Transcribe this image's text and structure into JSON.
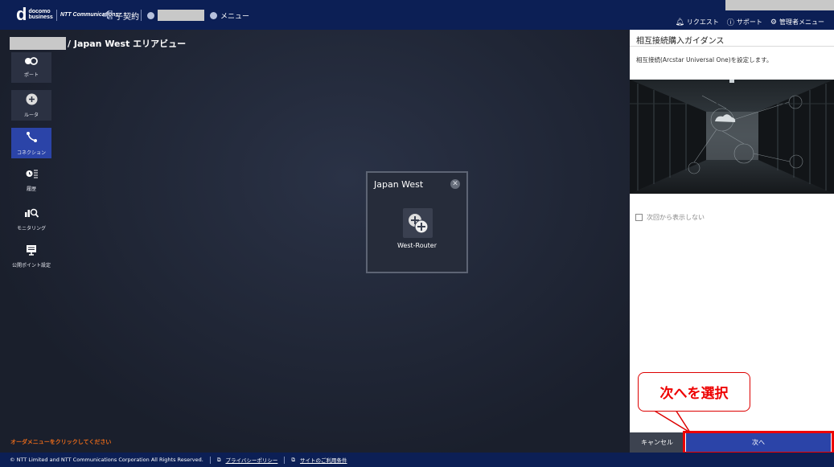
{
  "header": {
    "brand_top": "docomo",
    "brand_bottom": "business",
    "ntt_logo": "NTT Communications",
    "sub_contract_label": "子契約",
    "menu_label": "メニュー",
    "nav": [
      {
        "label": "リクエスト",
        "icon": "bell-icon"
      },
      {
        "label": "サポート",
        "icon": "help-icon"
      },
      {
        "label": "管理者メニュー",
        "icon": "gear-icon"
      }
    ]
  },
  "breadcrumb": {
    "current": "/ Japan West エリアビュー"
  },
  "sidebar": {
    "items": [
      {
        "label": "ポート",
        "icon": "port-icon"
      },
      {
        "label": "ルータ",
        "icon": "router-icon"
      },
      {
        "label": "コネクション",
        "icon": "connection-icon",
        "active": true
      },
      {
        "label": "履歴",
        "icon": "history-icon"
      },
      {
        "label": "モニタリング",
        "icon": "monitoring-icon"
      },
      {
        "label": "公開ポイント設定",
        "icon": "public-point-icon"
      }
    ]
  },
  "main": {
    "order_hint": "オーダメニューをクリックしてください",
    "area_card": {
      "title": "Japan West",
      "router_label": "West-Router"
    }
  },
  "panel": {
    "title": "相互接続購入ガイダンス",
    "description": "相互接続(Arcstar Universal One)を設定します。",
    "checkbox_label": "次回から表示しない",
    "cancel_label": "キャンセル",
    "next_label": "次へ"
  },
  "annotation": {
    "callout_text": "次へを選択",
    "color": "#e00000"
  },
  "footer": {
    "copyright": "© NTT Limited and NTT Communications Corporation All Rights Reserved.",
    "privacy_link": "プライバシーポリシー",
    "terms_link": "サイトのご利用条件"
  },
  "colors": {
    "topbar": "#0c1f55",
    "accent": "#2b44a8",
    "warning_text": "#e86a1a"
  }
}
